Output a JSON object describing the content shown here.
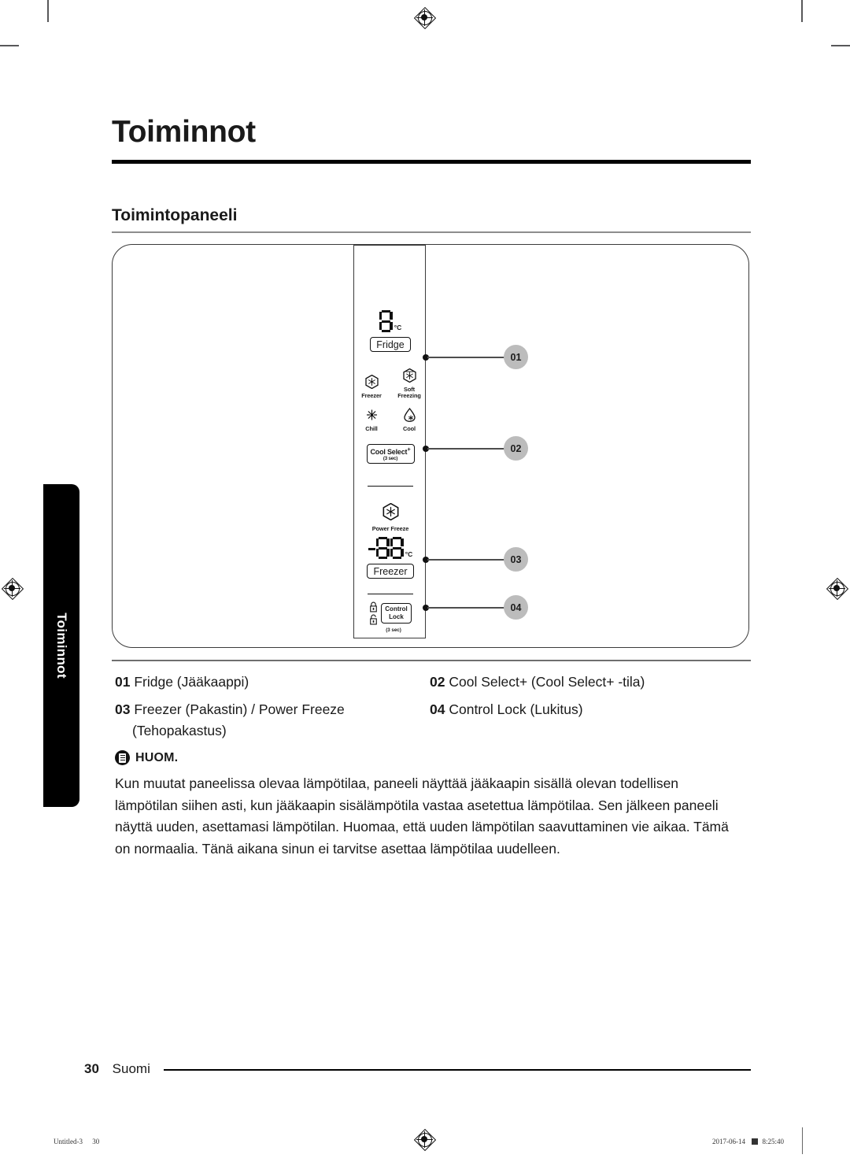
{
  "document": {
    "page_title": "Toiminnot",
    "section_title": "Toimintopaneeli",
    "side_tab_label": "Toiminnot"
  },
  "panel": {
    "fridge": {
      "display_value": "8",
      "unit": "°C",
      "button_label": "Fridge"
    },
    "modes": [
      {
        "icon": "snowflake-hex-icon",
        "label": "Freezer"
      },
      {
        "icon": "snowflake-soft-freezing-icon",
        "label": "Soft\nFreezing"
      },
      {
        "icon": "chill-sun-icon",
        "label": "Chill"
      },
      {
        "icon": "cool-droplet-icon",
        "label": "Cool"
      }
    ],
    "modes_labels": {
      "freezer": "Freezer",
      "soft_freezing_line1": "Soft",
      "soft_freezing_line2": "Freezing",
      "chill": "Chill",
      "cool": "Cool"
    },
    "cool_select": {
      "button_label": "Cool Select",
      "superscript": "+",
      "hold_hint": "(3 sec)"
    },
    "power_freeze": {
      "icon": "snowflake-hex-icon",
      "label": "Power Freeze"
    },
    "freezer": {
      "display_sign": "-",
      "display_value": "88",
      "unit": "°C",
      "button_label": "Freezer"
    },
    "control_lock": {
      "icon_locked": "lock-closed-icon",
      "icon_unlocked": "lock-open-icon",
      "button_label_line1": "Control",
      "button_label_line2": "Lock",
      "hold_hint": "(3 sec)"
    },
    "callouts": [
      "01",
      "02",
      "03",
      "04"
    ]
  },
  "legend": [
    {
      "num": "01",
      "text": "Fridge (Jääkaappi)"
    },
    {
      "num": "02",
      "text": "Cool Select+ (Cool Select+ -tila)"
    },
    {
      "num": "03",
      "text": "Freezer (Pakastin) / Power Freeze",
      "text2": "(Tehopakastus)"
    },
    {
      "num": "04",
      "text": "Control Lock (Lukitus)"
    }
  ],
  "note": {
    "icon": "note-document-icon",
    "title": "HUOM.",
    "body": "Kun muutat paneelissa olevaa lämpötilaa, paneeli näyttää jääkaapin sisällä olevan todellisen lämpötilan siihen asti, kun jääkaapin sisälämpötila vastaa asetettua lämpötilaa. Sen jälkeen paneeli näyttä uuden, asettamasi lämpötilan. Huomaa, että uuden lämpötilan saavuttaminen vie aikaa. Tämä on normaalia. Tänä aikana sinun ei tarvitse asettaa lämpötilaa uudelleen."
  },
  "footer": {
    "page_number": "30",
    "language": "Suomi"
  },
  "print_marks": {
    "file_name": "Untitled-3",
    "file_page": "30",
    "date": "2017-06-14",
    "time": "8:25:40"
  }
}
